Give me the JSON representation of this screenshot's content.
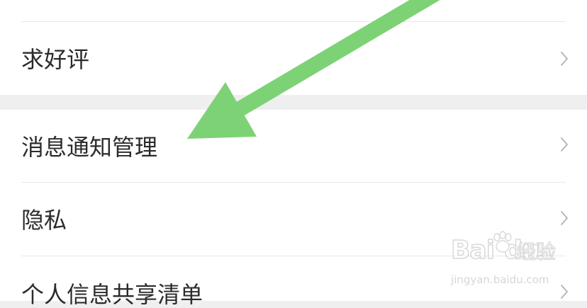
{
  "settings": {
    "items": [
      {
        "label": "求好评",
        "chevron": "chevron-right-icon"
      },
      {
        "label": "消息通知管理",
        "chevron": "chevron-right-icon"
      },
      {
        "label": "隐私",
        "chevron": "chevron-right-icon"
      },
      {
        "label": "个人信息共享清单",
        "chevron": "chevron-right-icon"
      }
    ]
  },
  "watermark": {
    "brand": "Bai",
    "brand_tail": "du",
    "suffix": "经验",
    "url": "jingyan.baidu.com"
  },
  "annotation": {
    "arrow_color": "#7dd275",
    "points_to": "消息通知管理"
  },
  "colors": {
    "background": "#efefef",
    "card": "#ffffff",
    "text": "#2b2b2b",
    "chevron": "#b3b3b3"
  }
}
